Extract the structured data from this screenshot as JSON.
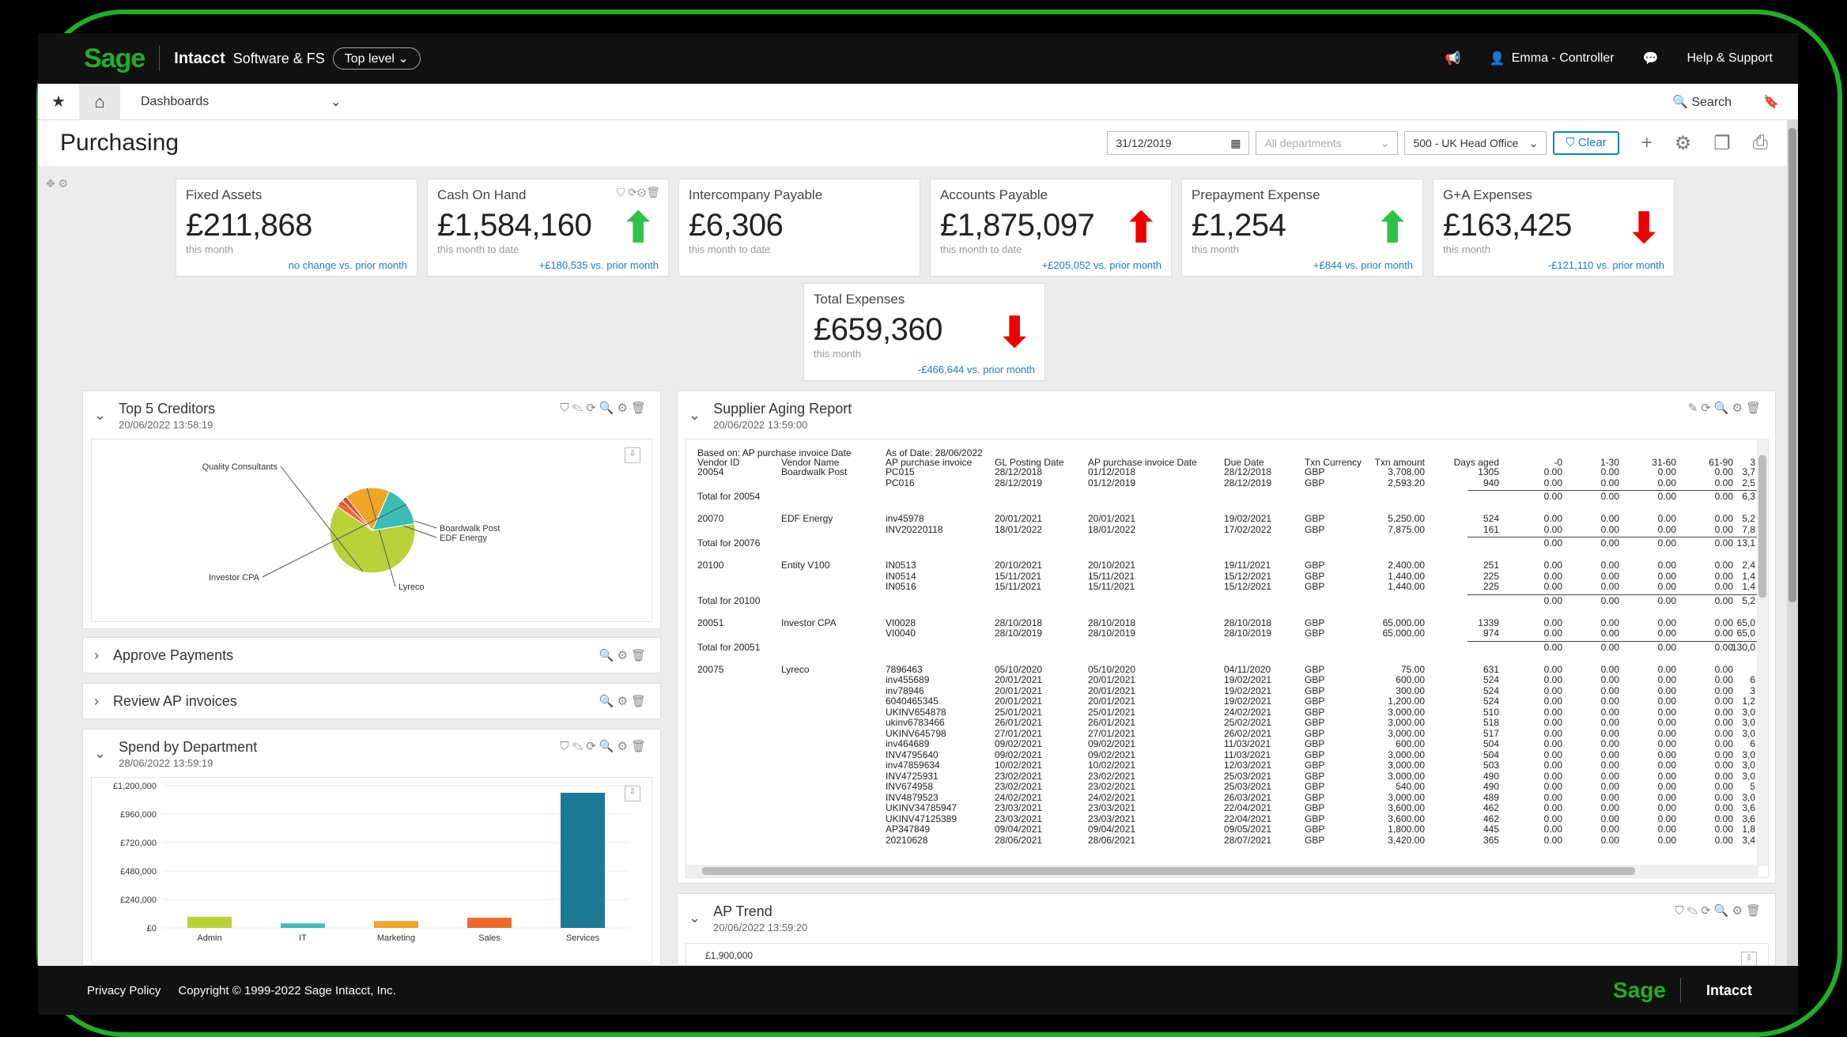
{
  "app": {
    "brand_logo": "Sage",
    "product": "Intacct",
    "company": "Software & FS",
    "level": "Top level ⌄",
    "user": "Emma - Controller",
    "help": "Help & Support",
    "nav_dashboards": "Dashboards",
    "search": "Search",
    "accent_color": "#1fb025"
  },
  "page": {
    "title": "Purchasing",
    "date_filter": "31/12/2019",
    "department_placeholder": "All departments",
    "entity": "500 - UK Head Office",
    "clear": "Clear"
  },
  "kpis": [
    {
      "title": "Fixed Assets",
      "value": "£211,868",
      "sub": "this month",
      "change": "no change vs. prior month",
      "trend": "none"
    },
    {
      "title": "Cash On Hand",
      "value": "£1,584,160",
      "sub": "this month to date",
      "change": "+£180,535 vs. prior month",
      "trend": "up"
    },
    {
      "title": "Intercompany Payable",
      "value": "£6,306",
      "sub": "this month to date",
      "change": "",
      "trend": "none"
    },
    {
      "title": "Accounts Payable",
      "value": "£1,875,097",
      "sub": "this month to date",
      "change": "+£205,052 vs. prior month",
      "trend": "up-red"
    },
    {
      "title": "Prepayment Expense",
      "value": "£1,254",
      "sub": "this month",
      "change": "+£844 vs. prior month",
      "trend": "up"
    },
    {
      "title": "G+A Expenses",
      "value": "£163,425",
      "sub": "this month",
      "change": "-£121,110 vs. prior month",
      "trend": "down"
    },
    {
      "title": "Total Expenses",
      "value": "£659,360",
      "sub": "this month",
      "change": "-£466,644 vs. prior month",
      "trend": "down"
    }
  ],
  "panels": {
    "top5": {
      "title": "Top 5 Creditors",
      "date": "20/06/2022 13:58:19"
    },
    "approve": {
      "title": "Approve Payments"
    },
    "review": {
      "title": "Review AP invoices"
    },
    "spend": {
      "title": "Spend by Department",
      "date": "28/06/2022 13:59:19"
    },
    "aging": {
      "title": "Supplier Aging Report",
      "date": "20/06/2022 13:59:00"
    },
    "trend": {
      "title": "AP Trend",
      "date": "20/06/2022 13:59:20",
      "y_top": "£1,900,000"
    }
  },
  "chart_data": [
    {
      "type": "pie",
      "title": "",
      "categories": [
        "Quality Consultants",
        "Investor CPA",
        "Lyreco",
        "EDF Energy",
        "Boardwalk Post"
      ],
      "values": [
        62,
        16,
        17,
        3,
        2
      ],
      "colors": [
        "#b9d23a",
        "#3cbcb7",
        "#f0a527",
        "#f06a2b",
        "#e8463a"
      ]
    },
    {
      "type": "bar",
      "title": "",
      "categories": [
        "Admin",
        "IT",
        "Marketing",
        "Sales",
        "Services"
      ],
      "values": [
        95000,
        38000,
        58000,
        86000,
        1140000
      ],
      "colors": [
        "#b9d23a",
        "#3cbcb7",
        "#f0a527",
        "#f06a2b",
        "#1d7a96"
      ],
      "yticks": [
        "£1,200,000",
        "£960,000",
        "£720,000",
        "£480,000",
        "£240,000",
        "£0"
      ],
      "ylim": [
        0,
        1200000
      ]
    }
  ],
  "aging": {
    "based_on": "Based on: AP purchase invoice Date",
    "as_of": "As of Date: 28/06/2022",
    "headers": [
      "Vendor ID",
      "Vendor Name",
      "AP purchase invoice",
      "GL Posting Date",
      "AP purchase invoice Date",
      "Due Date",
      "Txn Currency",
      "Txn amount",
      "Days aged",
      "-0",
      "1-30",
      "31-60",
      "61-90",
      "3"
    ],
    "rows": [
      [
        "20054",
        "Boardwalk Post",
        "PC015",
        "28/12/2018",
        "01/12/2018",
        "28/12/2018",
        "GBP",
        "3,708.00",
        "1305",
        "0.00",
        "0.00",
        "0.00",
        "0.00",
        "3,7"
      ],
      [
        "",
        "",
        "PC016",
        "28/12/2019",
        "01/12/2019",
        "28/12/2019",
        "GBP",
        "2,593.20",
        "940",
        "0.00",
        "0.00",
        "0.00",
        "0.00",
        "2,5"
      ],
      [
        "Total for 20054",
        "",
        "",
        "",
        "",
        "",
        "",
        "",
        "",
        "0.00",
        "0.00",
        "0.00",
        "0.00",
        "6,3"
      ],
      [
        "20070",
        "EDF Energy",
        "inv45978",
        "20/01/2021",
        "20/01/2021",
        "19/02/2021",
        "GBP",
        "5,250.00",
        "524",
        "0.00",
        "0.00",
        "0.00",
        "0.00",
        "5,2"
      ],
      [
        "",
        "",
        "INV20220118",
        "18/01/2022",
        "18/01/2022",
        "17/02/2022",
        "GBP",
        "7,875.00",
        "161",
        "0.00",
        "0.00",
        "0.00",
        "0.00",
        "7,8"
      ],
      [
        "Total for 20076",
        "",
        "",
        "",
        "",
        "",
        "",
        "",
        "",
        "0.00",
        "0.00",
        "0.00",
        "0.00",
        "13,1"
      ],
      [
        "20100",
        "Entity V100",
        "IN0513",
        "20/10/2021",
        "20/10/2021",
        "19/11/2021",
        "GBP",
        "2,400.00",
        "251",
        "0.00",
        "0.00",
        "0.00",
        "0.00",
        "2,4"
      ],
      [
        "",
        "",
        "IN0514",
        "15/11/2021",
        "15/11/2021",
        "15/12/2021",
        "GBP",
        "1,440.00",
        "225",
        "0.00",
        "0.00",
        "0.00",
        "0.00",
        "1,4"
      ],
      [
        "",
        "",
        "IN0516",
        "15/11/2021",
        "15/11/2021",
        "15/12/2021",
        "GBP",
        "1,440.00",
        "225",
        "0.00",
        "0.00",
        "0.00",
        "0.00",
        "1,4"
      ],
      [
        "Total for 20100",
        "",
        "",
        "",
        "",
        "",
        "",
        "",
        "",
        "0.00",
        "0.00",
        "0.00",
        "0.00",
        "5,2"
      ],
      [
        "20051",
        "Investor CPA",
        "VI0028",
        "28/10/2018",
        "28/10/2018",
        "28/10/2018",
        "GBP",
        "65,000.00",
        "1339",
        "0.00",
        "0.00",
        "0.00",
        "0.00",
        "65,0"
      ],
      [
        "",
        "",
        "VI0040",
        "28/10/2019",
        "28/10/2019",
        "28/10/2019",
        "GBP",
        "65,000.00",
        "974",
        "0.00",
        "0.00",
        "0.00",
        "0.00",
        "65,0"
      ],
      [
        "Total for 20051",
        "",
        "",
        "",
        "",
        "",
        "",
        "",
        "",
        "0.00",
        "0.00",
        "0.00",
        "0.00",
        "130,0"
      ],
      [
        "20075",
        "Lyreco",
        "7896463",
        "05/10/2020",
        "05/10/2020",
        "04/11/2020",
        "GBP",
        "75.00",
        "631",
        "0.00",
        "0.00",
        "0.00",
        "0.00",
        ""
      ],
      [
        "",
        "",
        "inv455689",
        "20/01/2021",
        "20/01/2021",
        "19/02/2021",
        "GBP",
        "600.00",
        "524",
        "0.00",
        "0.00",
        "0.00",
        "0.00",
        "6"
      ],
      [
        "",
        "",
        "inv78946",
        "20/01/2021",
        "20/01/2021",
        "19/02/2021",
        "GBP",
        "300.00",
        "524",
        "0.00",
        "0.00",
        "0.00",
        "0.00",
        "3"
      ],
      [
        "",
        "",
        "6040465345",
        "20/01/2021",
        "20/01/2021",
        "19/02/2021",
        "GBP",
        "1,200.00",
        "524",
        "0.00",
        "0.00",
        "0.00",
        "0.00",
        "1,2"
      ],
      [
        "",
        "",
        "UKINV654878",
        "25/01/2021",
        "25/01/2021",
        "24/02/2021",
        "GBP",
        "3,000.00",
        "510",
        "0.00",
        "0.00",
        "0.00",
        "0.00",
        "3,0"
      ],
      [
        "",
        "",
        "ukinv6783466",
        "26/01/2021",
        "26/01/2021",
        "25/02/2021",
        "GBP",
        "3,000.00",
        "518",
        "0.00",
        "0.00",
        "0.00",
        "0.00",
        "3,0"
      ],
      [
        "",
        "",
        "UKINV645798",
        "27/01/2021",
        "27/01/2021",
        "26/02/2021",
        "GBP",
        "3,000.00",
        "517",
        "0.00",
        "0.00",
        "0.00",
        "0.00",
        "3,0"
      ],
      [
        "",
        "",
        "inv464689",
        "09/02/2021",
        "09/02/2021",
        "11/03/2021",
        "GBP",
        "600.00",
        "504",
        "0.00",
        "0.00",
        "0.00",
        "0.00",
        "6"
      ],
      [
        "",
        "",
        "INV4795640",
        "09/02/2021",
        "09/02/2021",
        "11/03/2021",
        "GBP",
        "3,000.00",
        "504",
        "0.00",
        "0.00",
        "0.00",
        "0.00",
        "3,0"
      ],
      [
        "",
        "",
        "inv47859634",
        "10/02/2021",
        "10/02/2021",
        "12/03/2021",
        "GBP",
        "3,000.00",
        "503",
        "0.00",
        "0.00",
        "0.00",
        "0.00",
        "3,0"
      ],
      [
        "",
        "",
        "INV4725931",
        "23/02/2021",
        "23/02/2021",
        "25/03/2021",
        "GBP",
        "3,000.00",
        "490",
        "0.00",
        "0.00",
        "0.00",
        "0.00",
        "3,0"
      ],
      [
        "",
        "",
        "INV674958",
        "23/02/2021",
        "23/02/2021",
        "25/03/2021",
        "GBP",
        "540.00",
        "490",
        "0.00",
        "0.00",
        "0.00",
        "0.00",
        "5"
      ],
      [
        "",
        "",
        "INV4879523",
        "24/02/2021",
        "24/02/2021",
        "26/03/2021",
        "GBP",
        "3,000.00",
        "489",
        "0.00",
        "0.00",
        "0.00",
        "0.00",
        "3,0"
      ],
      [
        "",
        "",
        "UKINV34785947",
        "23/03/2021",
        "23/03/2021",
        "22/04/2021",
        "GBP",
        "3,600.00",
        "462",
        "0.00",
        "0.00",
        "0.00",
        "0.00",
        "3,6"
      ],
      [
        "",
        "",
        "UKINV47125389",
        "23/03/2021",
        "23/03/2021",
        "22/04/2021",
        "GBP",
        "3,600.00",
        "462",
        "0.00",
        "0.00",
        "0.00",
        "0.00",
        "3,6"
      ],
      [
        "",
        "",
        "AP347849",
        "09/04/2021",
        "09/04/2021",
        "09/05/2021",
        "GBP",
        "1,800.00",
        "445",
        "0.00",
        "0.00",
        "0.00",
        "0.00",
        "1,8"
      ],
      [
        "",
        "",
        "20210628",
        "28/06/2021",
        "28/06/2021",
        "28/07/2021",
        "GBP",
        "3,420.00",
        "365",
        "0.00",
        "0.00",
        "0.00",
        "0.00",
        "3,4"
      ]
    ]
  },
  "footer": {
    "privacy": "Privacy Policy",
    "copyright": "Copyright © 1999-2022 Sage Intacct, Inc.",
    "logo": "Sage",
    "product": "Intacct"
  }
}
